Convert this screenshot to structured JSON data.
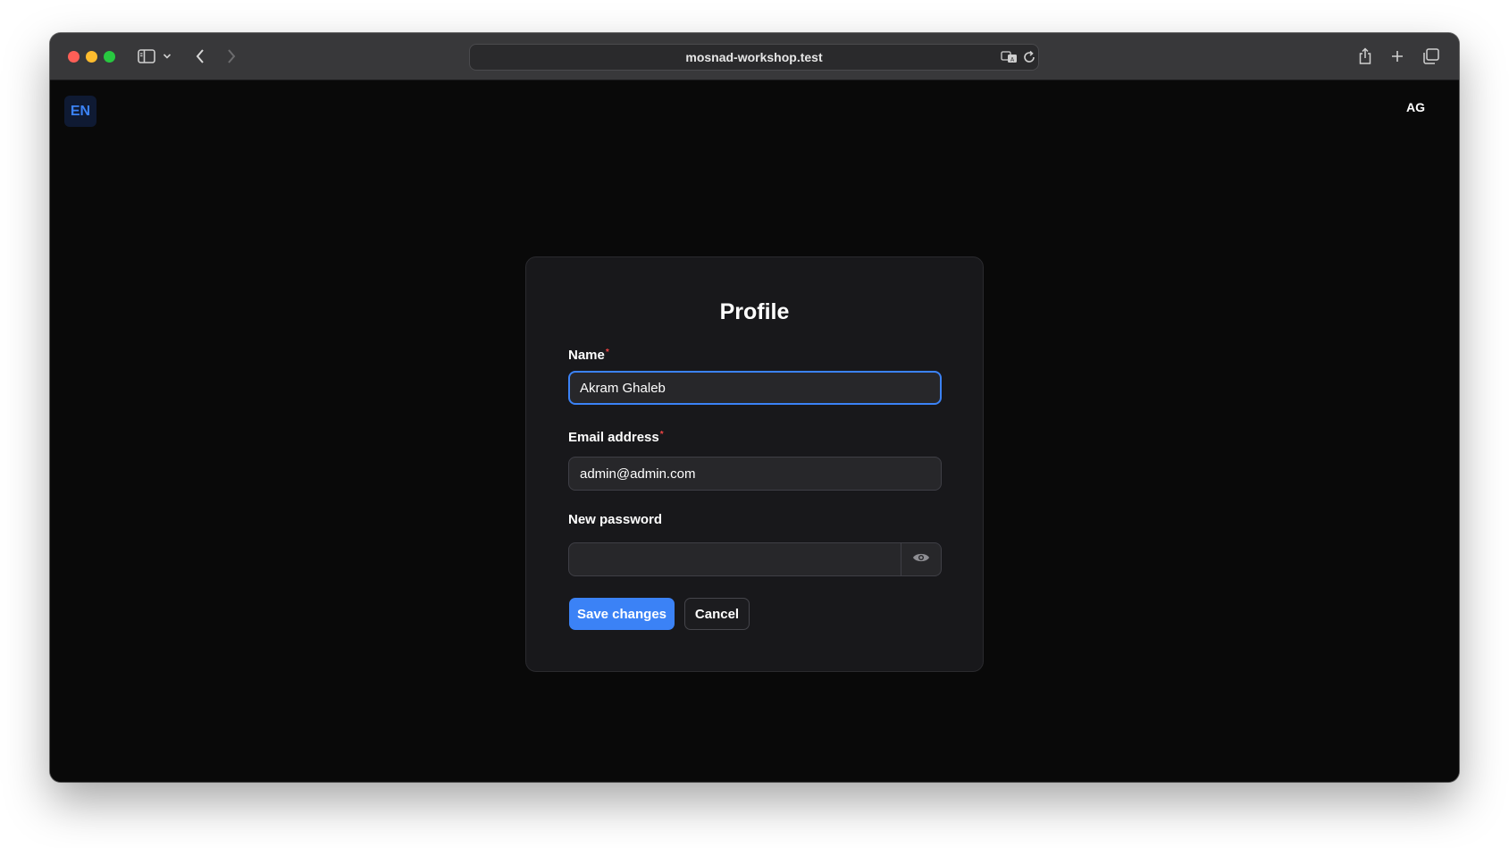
{
  "browser": {
    "url": "mosnad-workshop.test",
    "icons": [
      "sidebar-icon",
      "chevron-down-icon",
      "back-icon",
      "forward-icon",
      "translate-icon",
      "reload-icon",
      "share-icon",
      "plus-icon",
      "tabs-overview-icon"
    ]
  },
  "header": {
    "language": "EN",
    "user_initials": "AG"
  },
  "form": {
    "title": "Profile",
    "name_label": "Name",
    "name_value": "Akram Ghaleb",
    "email_label": "Email address",
    "email_value": "admin@admin.com",
    "password_label": "New password",
    "password_value": "",
    "required_mark": "*",
    "save_label": "Save changes",
    "cancel_label": "Cancel"
  },
  "colors": {
    "accent": "#3b82f6",
    "background": "#090909",
    "card": "#18181b",
    "required": "#ef4444"
  }
}
